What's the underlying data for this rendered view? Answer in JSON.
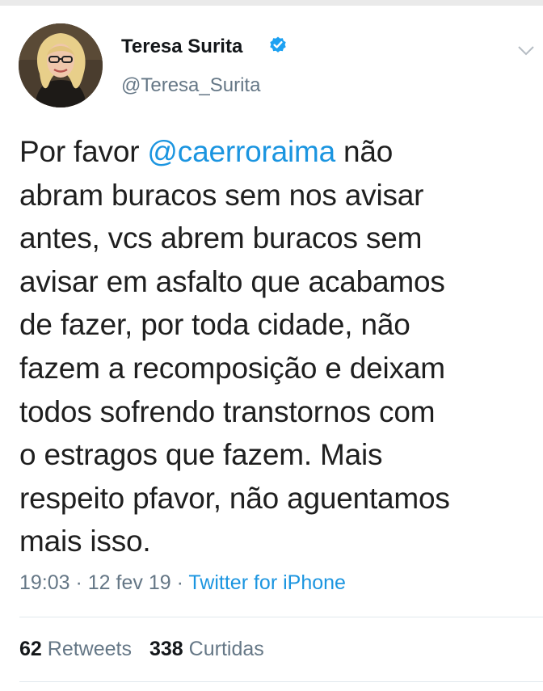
{
  "profile": {
    "display_name": "Teresa Surita",
    "handle": "@Teresa_Surita",
    "verified": true
  },
  "tweet": {
    "lines": [
      {
        "before": "Por favor ",
        "mention": "@caerroraima",
        "after": " não"
      },
      {
        "text": "abram buracos sem nos avisar"
      },
      {
        "text": "antes, vcs abrem buracos sem"
      },
      {
        "text": "avisar em asfalto que acabamos"
      },
      {
        "text": "de fazer, por toda cidade, não"
      },
      {
        "text": "fazem a recomposição e deixam"
      },
      {
        "text": "todos sofrendo transtornos com"
      },
      {
        "text": "o estragos que fazem. Mais"
      },
      {
        "text": "respeito  pfavor, não aguentamos"
      },
      {
        "text": "mais isso."
      }
    ]
  },
  "meta": {
    "time": "19:03",
    "separator": " · ",
    "date": "12 fev 19",
    "source": "Twitter for iPhone"
  },
  "stats": {
    "retweets_count": "62",
    "retweets_label": "Retweets",
    "likes_count": "338",
    "likes_label": "Curtidas"
  },
  "colors": {
    "link": "#1b95e0",
    "secondary_text": "#657786",
    "primary_text": "#14171a",
    "verified_badge": "#1da1f2"
  },
  "icons": {
    "verified": "verified-badge-icon",
    "menu": "chevron-down-icon"
  }
}
